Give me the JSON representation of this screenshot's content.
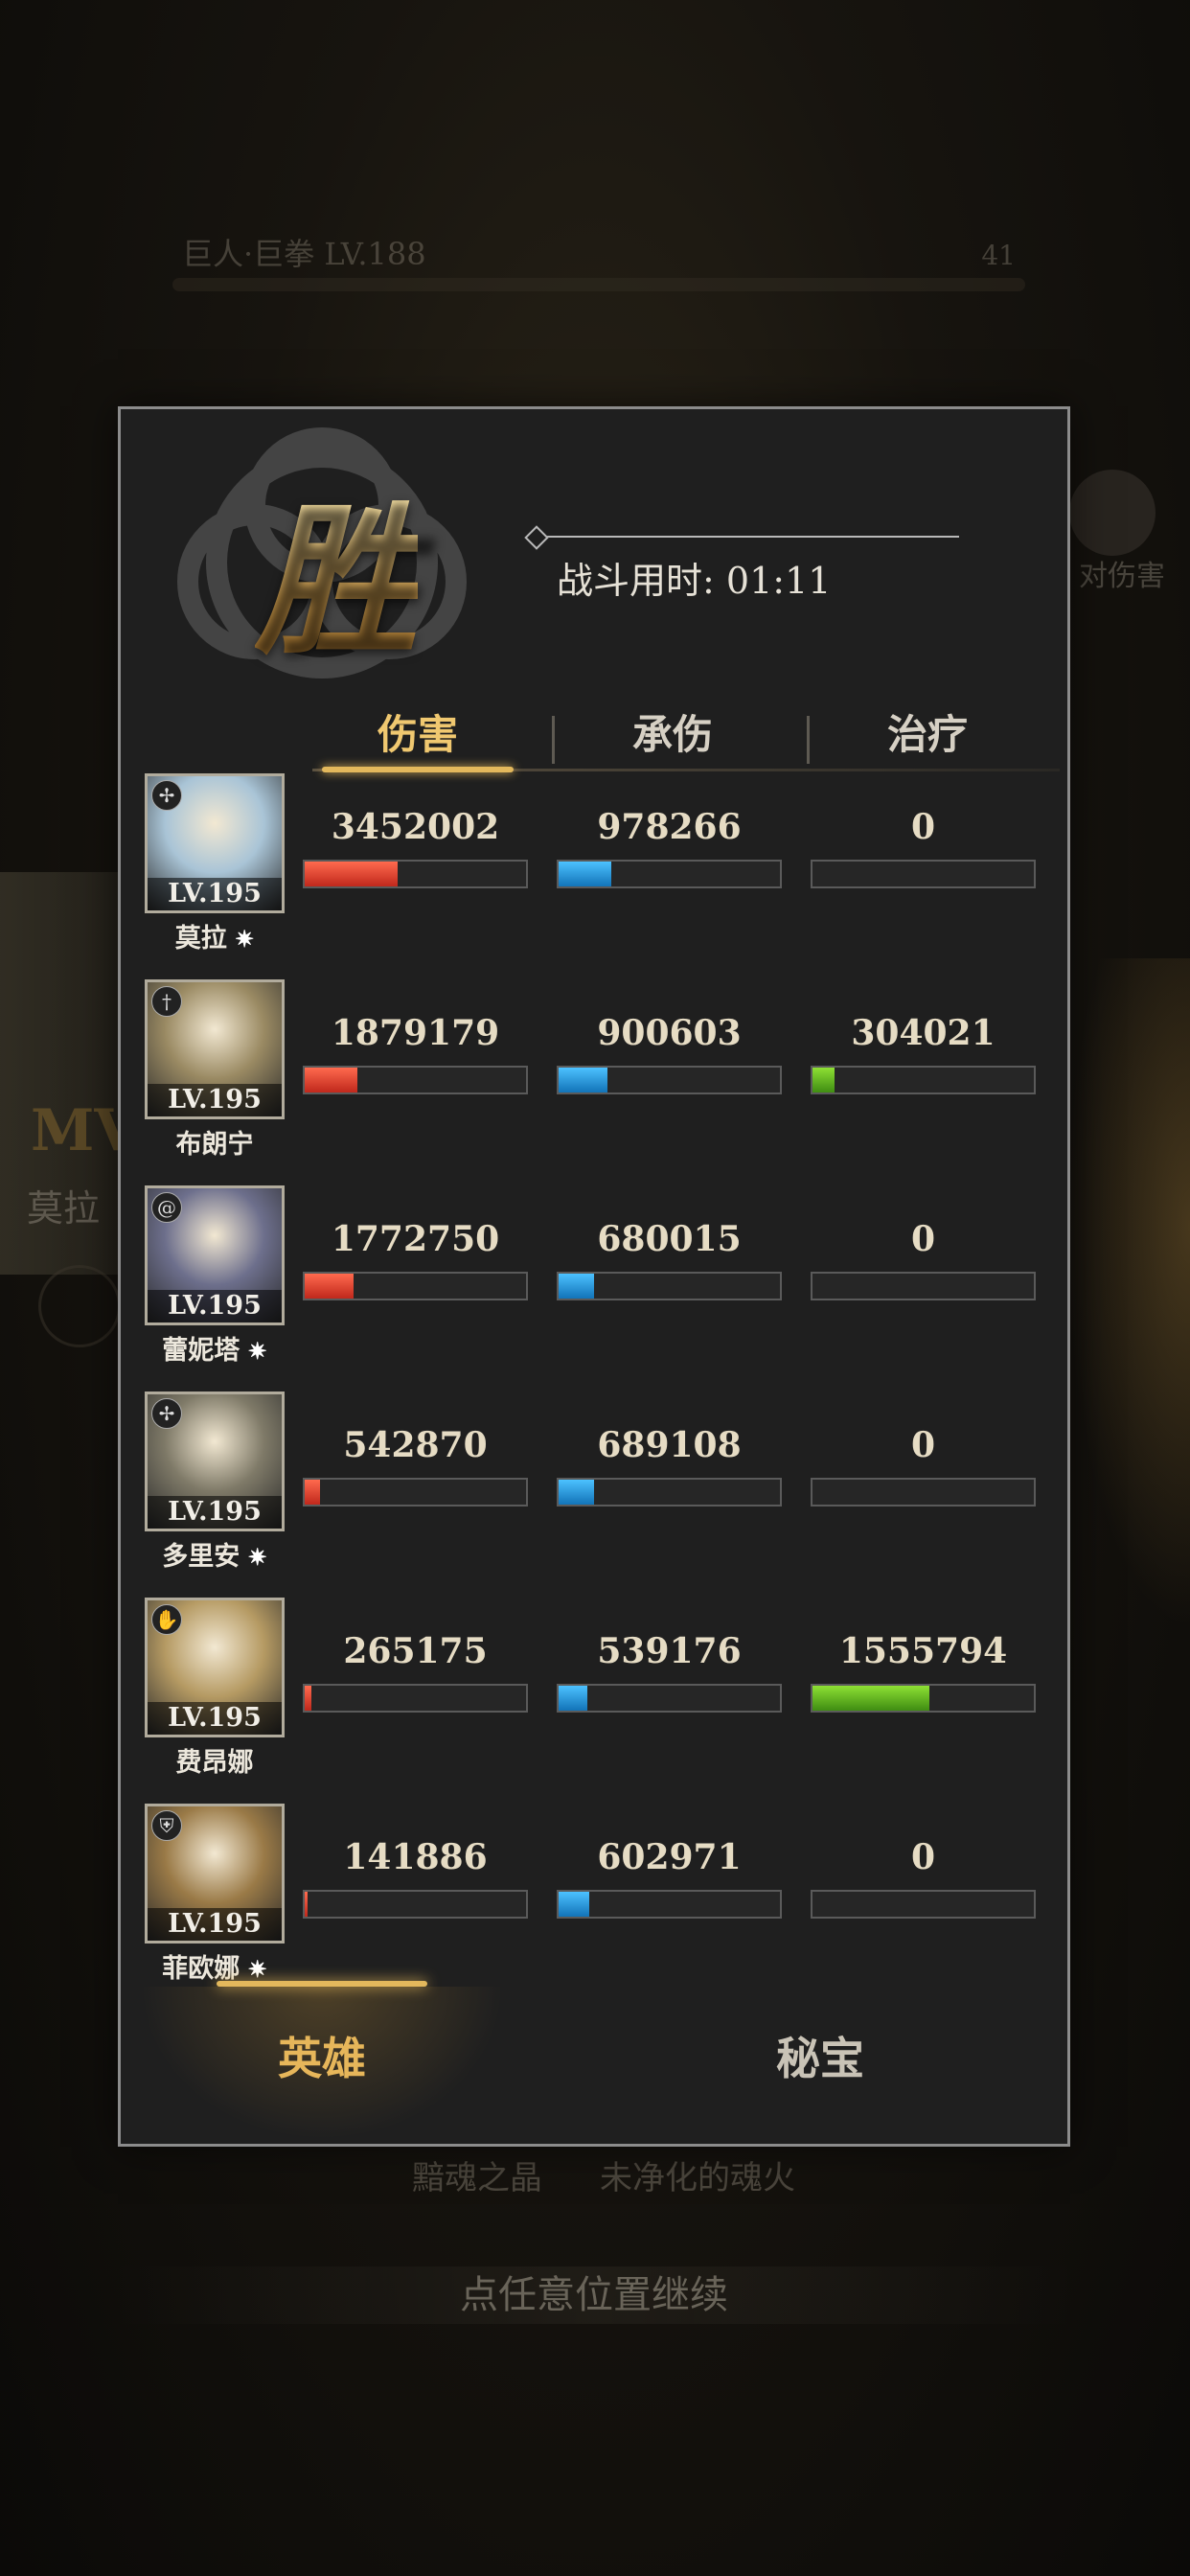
{
  "background": {
    "boss_label": "巨人·巨拳 LV.188",
    "boss_count": "41",
    "mvp_partial": "MV",
    "mvp_name_partial": "莫拉",
    "right_label_partial": "对伤害",
    "item_1": "黯魂之晶",
    "item_2": "未净化的魂火",
    "continue_hint": "点任意位置继续"
  },
  "result": {
    "victory_mark": "胜",
    "battle_time_label": "战斗用时:",
    "battle_time_value": "01:11"
  },
  "tabs": {
    "damage": "伤害",
    "taken": "承伤",
    "heal": "治疗",
    "active": "damage"
  },
  "heroes": [
    {
      "name": "莫拉",
      "star": true,
      "level": "LV.195",
      "class_icon": "archer-icon",
      "damage": "3452002",
      "taken": "978266",
      "heal": "0",
      "damage_frac": 0.42,
      "taken_frac": 0.24,
      "heal_frac": 0,
      "art": "#a9c4d6"
    },
    {
      "name": "布朗宁",
      "star": false,
      "level": "LV.195",
      "class_icon": "sword-icon",
      "damage": "1879179",
      "taken": "900603",
      "heal": "304021",
      "damage_frac": 0.24,
      "taken_frac": 0.22,
      "heal_frac": 0.1,
      "art": "#9a8a63"
    },
    {
      "name": "蕾妮塔",
      "star": true,
      "level": "LV.195",
      "class_icon": "spiral-icon",
      "damage": "1772750",
      "taken": "680015",
      "heal": "0",
      "damage_frac": 0.22,
      "taken_frac": 0.16,
      "heal_frac": 0,
      "art": "#6d6f8c"
    },
    {
      "name": "多里安",
      "star": true,
      "level": "LV.195",
      "class_icon": "archer-icon",
      "damage": "542870",
      "taken": "689108",
      "heal": "0",
      "damage_frac": 0.07,
      "taken_frac": 0.16,
      "heal_frac": 0,
      "art": "#7f7a68"
    },
    {
      "name": "费昂娜",
      "star": false,
      "level": "LV.195",
      "class_icon": "hand-icon",
      "damage": "265175",
      "taken": "539176",
      "heal": "1555794",
      "damage_frac": 0.03,
      "taken_frac": 0.13,
      "heal_frac": 0.53,
      "art": "#b59a63"
    },
    {
      "name": "菲欧娜",
      "star": true,
      "level": "LV.195",
      "class_icon": "shield-icon",
      "damage": "141886",
      "taken": "602971",
      "heal": "0",
      "damage_frac": 0.015,
      "taken_frac": 0.14,
      "heal_frac": 0,
      "art": "#9a7a47"
    }
  ],
  "bottom_tabs": {
    "heroes": "英雄",
    "treasures": "秘宝",
    "active": "heroes"
  },
  "colors": {
    "damage": "#d8392a",
    "taken": "#2490d6",
    "heal": "#6cc022",
    "accent": "#e3b85c"
  }
}
